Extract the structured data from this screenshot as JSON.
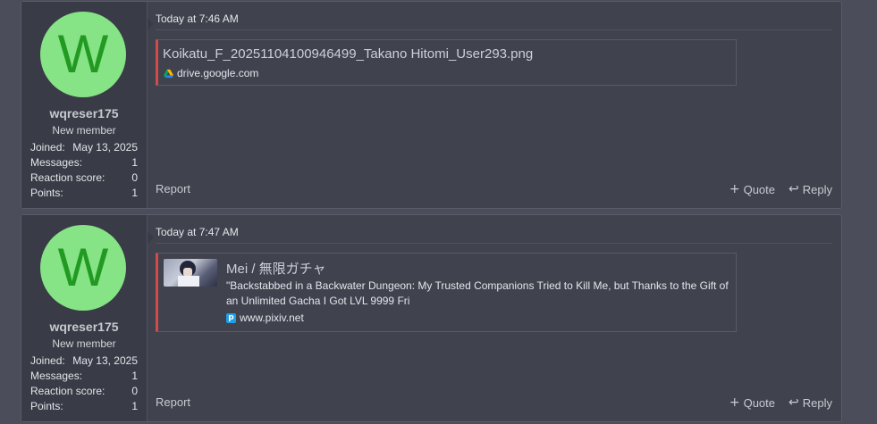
{
  "posts": [
    {
      "user": {
        "avatar_letter": "W",
        "name": "wqreser175",
        "title": "New member",
        "stats": [
          {
            "label": "Joined:",
            "value": "May 13, 2025"
          },
          {
            "label": "Messages:",
            "value": "1"
          },
          {
            "label": "Reaction score:",
            "value": "0"
          },
          {
            "label": "Points:",
            "value": "1"
          }
        ]
      },
      "date": "Today at 7:46 AM",
      "embed": {
        "title": "Koikatu_F_20251104100946499_Takano Hitomi_User293.png",
        "site": "drive.google.com",
        "site_icon": "google-drive-icon"
      },
      "report_label": "Report",
      "quote_label": "Quote",
      "reply_label": "Reply"
    },
    {
      "user": {
        "avatar_letter": "W",
        "name": "wqreser175",
        "title": "New member",
        "stats": [
          {
            "label": "Joined:",
            "value": "May 13, 2025"
          },
          {
            "label": "Messages:",
            "value": "1"
          },
          {
            "label": "Reaction score:",
            "value": "0"
          },
          {
            "label": "Points:",
            "value": "1"
          }
        ]
      },
      "date": "Today at 7:47 AM",
      "embed": {
        "title": "Mei / 無限ガチャ",
        "description": "\"Backstabbed in a Backwater Dungeon: My Trusted Companions Tried to Kill Me, but Thanks to the Gift of an Unlimited Gacha I Got LVL 9999 Fri",
        "site": "www.pixiv.net",
        "site_icon": "pixiv-icon"
      },
      "report_label": "Report",
      "quote_label": "Quote",
      "reply_label": "Reply"
    }
  ],
  "colors": {
    "page_bg": "#4b4d5a",
    "post_bg": "#40424e",
    "user_panel_bg": "#393b46",
    "avatar_bg": "#86e386",
    "avatar_letter": "#229a22",
    "embed_accent": "#d24a4a"
  }
}
